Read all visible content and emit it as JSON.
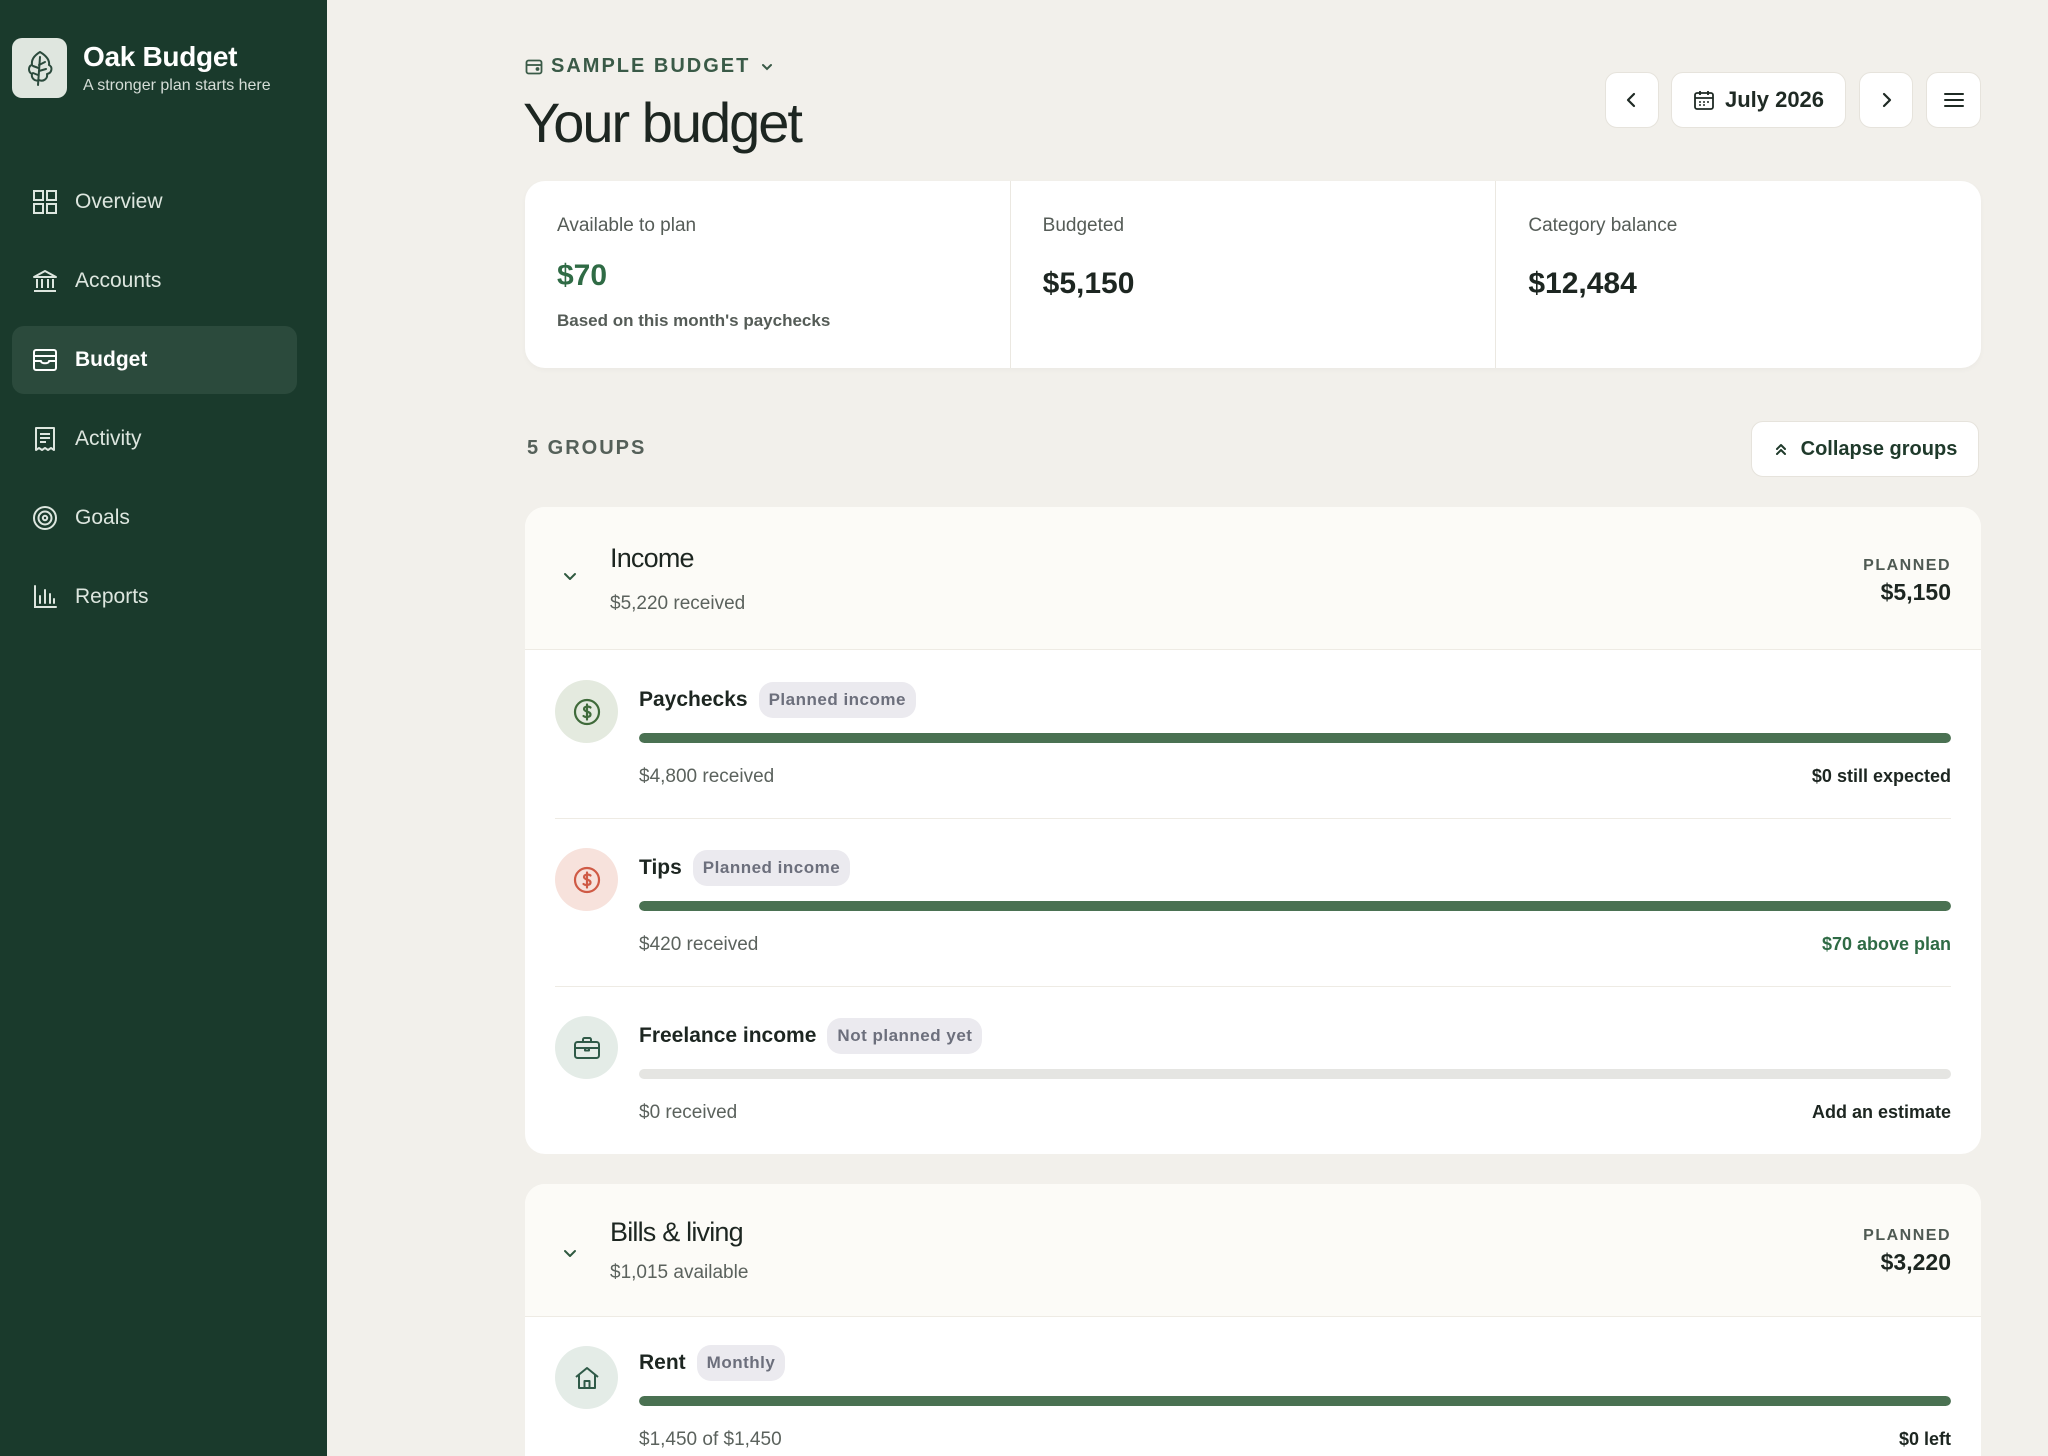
{
  "app": {
    "name": "Oak Budget",
    "tagline": "A stronger plan starts here",
    "logo_icon": "oak-leaf-icon"
  },
  "sidebar": {
    "items": [
      {
        "label": "Overview",
        "icon": "grid-icon",
        "active": false
      },
      {
        "label": "Accounts",
        "icon": "bank-icon",
        "active": false
      },
      {
        "label": "Budget",
        "icon": "wallet-icon",
        "active": true
      },
      {
        "label": "Activity",
        "icon": "receipt-icon",
        "active": false
      },
      {
        "label": "Goals",
        "icon": "target-icon",
        "active": false
      },
      {
        "label": "Reports",
        "icon": "bar-chart-icon",
        "active": false
      }
    ]
  },
  "header": {
    "budget_name": "SAMPLE BUDGET",
    "title": "Your budget",
    "month": "July 2026"
  },
  "summary": {
    "available_label": "Available to plan",
    "available_value": "$70",
    "available_note": "Based on this month's paychecks",
    "budgeted_label": "Budgeted",
    "budgeted_value": "$5,150",
    "balance_label": "Category balance",
    "balance_value": "$12,484"
  },
  "groups_bar": {
    "count_label": "5 GROUPS",
    "collapse_label": "Collapse groups"
  },
  "groups": [
    {
      "name": "Income",
      "sub": "$5,220 received",
      "planned_label": "PLANNED",
      "planned_value": "$5,150",
      "rows": [
        {
          "name": "Paychecks",
          "badge": "Planned income",
          "left": "$4,800 received",
          "right": "$0 still expected",
          "progress": 1.0,
          "icon": "dollar-icon"
        },
        {
          "name": "Tips",
          "badge": "Planned income",
          "left": "$420 received",
          "right": "$70 above plan",
          "progress": 1.0,
          "icon": "dollar-icon"
        },
        {
          "name": "Freelance income",
          "badge": "Not planned yet",
          "left": "$0 received",
          "right": "Add an estimate",
          "progress": 0.0,
          "icon": "briefcase-icon"
        }
      ]
    },
    {
      "name": "Bills & living",
      "sub": "$1,015 available",
      "planned_label": "PLANNED",
      "planned_value": "$3,220",
      "rows": [
        {
          "name": "Rent",
          "badge": "Monthly",
          "left": "$1,450 of $1,450",
          "right": "$0 left",
          "progress": 1.0,
          "icon": "home-icon"
        }
      ]
    }
  ],
  "colors": {
    "sidebar": "#1a3a2c",
    "accent": "#2f6b45",
    "progress": "#4a7152",
    "background": "#f2f0eb"
  }
}
